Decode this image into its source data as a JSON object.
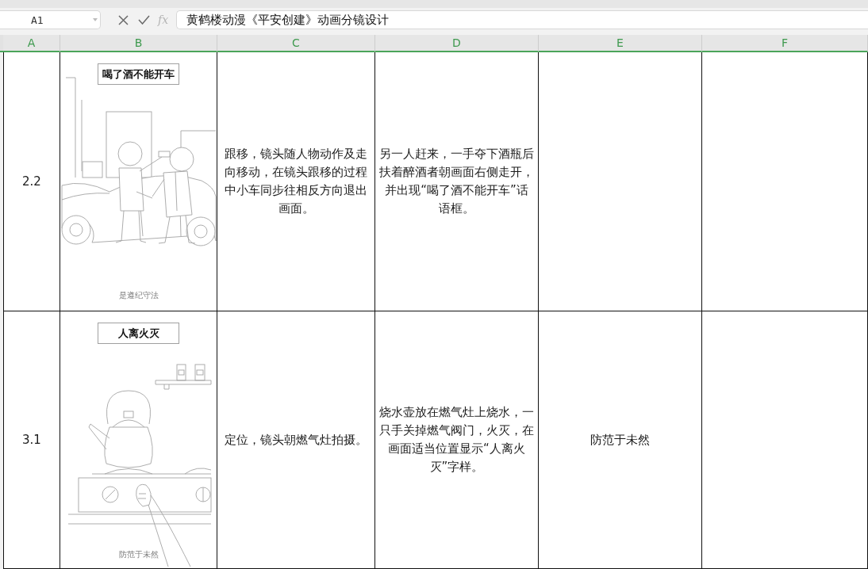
{
  "name_box": {
    "value": "A1"
  },
  "formula_bar": {
    "function_label": "fx",
    "value": "黄鹤楼动漫《平安创建》动画分镜设计"
  },
  "columns": [
    {
      "label": "A",
      "selected": true
    },
    {
      "label": "B",
      "selected": true
    },
    {
      "label": "C",
      "selected": true
    },
    {
      "label": "D",
      "selected": true
    },
    {
      "label": "E",
      "selected": true
    },
    {
      "label": "F",
      "selected": true
    }
  ],
  "rows": [
    {
      "a": "2.2",
      "b": {
        "kind": "drink_driving_scene",
        "caption": "喝了酒不能开车",
        "footer": "是遵纪守法"
      },
      "c": "跟移，镜头随人物动作及走向移动，在镜头跟移的过程中小车同步往相反方向退出画面。",
      "d": "另一人赶来，一手夺下酒瓶后扶着醉酒者朝画面右侧走开，并出现“喝了酒不能开车”话语框。"
    },
    {
      "a": "3.1",
      "b": {
        "kind": "kitchen_stove_scene",
        "caption": "人离火灭",
        "footer": "防范于未然"
      },
      "c": "定位，镜头朝燃气灶拍摄。",
      "d": "烧水壶放在燃气灶上烧水，一只手关掉燃气阀门，火灭，在画面适当位置显示“人离火灭”字样。",
      "e": "防范于未然"
    }
  ]
}
